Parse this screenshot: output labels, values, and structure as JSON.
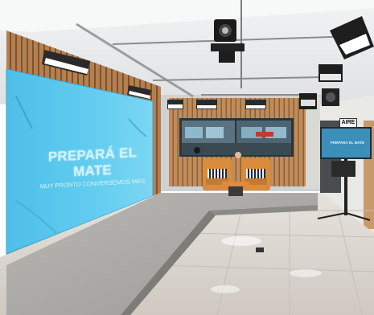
{
  "screen": {
    "title": "PREPARÁ EL MATE",
    "subtitle": "MUY PRONTO CONVERSEMOS MÁS"
  },
  "monitor": {
    "text": "PREPARÁ EL MATE"
  },
  "sign": {
    "text": "AIRE"
  },
  "colors": {
    "screen": "#5cc8ee",
    "wood": "#b07a4a",
    "ceiling": "#e7e9ea",
    "floor": "#d8d4cf",
    "stage": "#a9a8a4"
  }
}
